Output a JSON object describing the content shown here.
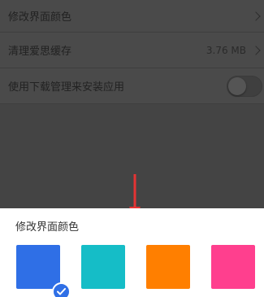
{
  "settings": [
    {
      "label": "修改界面颜色",
      "type": "link"
    },
    {
      "label": "清理爱思缓存",
      "value": "3.76 MB",
      "type": "link"
    },
    {
      "label": "使用下载管理来安装应用",
      "type": "toggle",
      "toggle_on": false
    }
  ],
  "sheet": {
    "title": "修改界面颜色",
    "swatches": [
      {
        "name": "blue",
        "color": "#2f6fe6",
        "selected": true
      },
      {
        "name": "teal",
        "color": "#15bdc7",
        "selected": false
      },
      {
        "name": "orange",
        "color": "#ff7f00",
        "selected": false
      },
      {
        "name": "pink",
        "color": "#ff3f8e",
        "selected": false
      }
    ]
  },
  "overlay": {
    "arrow_color": "#e53333"
  }
}
